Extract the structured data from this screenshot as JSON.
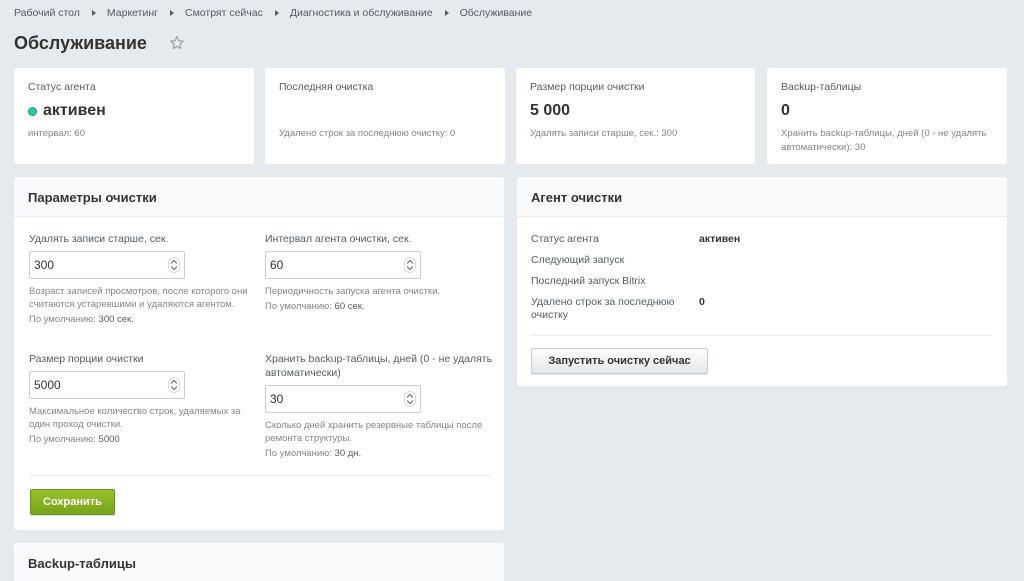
{
  "breadcrumb": [
    "Рабочий стол",
    "Маркетинг",
    "Смотрят сейчас",
    "Диагностика и обслуживание",
    "Обслуживание"
  ],
  "page_title": "Обслуживание",
  "colors": {
    "status_active": "#2fc6a4",
    "save_button": "#7db21d",
    "background": "#e4eaed"
  },
  "stats": [
    {
      "label": "Статус агента",
      "value": "активен",
      "note": "интервал: 60"
    },
    {
      "label": "Последняя очистка",
      "value": "",
      "note": "Удалено строк за последнюю очистку: 0"
    },
    {
      "label": "Размер порции очистки",
      "value": "5 000",
      "note": "Удалять записи старше, сек.: 300"
    },
    {
      "label": "Backup-таблицы",
      "value": "0",
      "note": "Хранить backup-таблицы, дней (0 - не удалять автоматически): 30"
    }
  ],
  "params": {
    "title": "Параметры очистки",
    "fields": [
      {
        "label": "Удалять записи старше, сек.",
        "value": "300",
        "help": "Возраст записей просмотров, после которого они считаются устаревшими и удаляются агентом.",
        "default_label": "По умолчанию:",
        "default_value": "300 сек."
      },
      {
        "label": "Интервал агента очистки, сек.",
        "value": "60",
        "help": "Периодичность запуска агента очистки.",
        "default_label": "По умолчанию:",
        "default_value": "60 сек."
      },
      {
        "label": "Размер порции очистки",
        "value": "5000",
        "help": "Максимальное количество строк, удаляемых за один проход очистки.",
        "default_label": "По умолчанию:",
        "default_value": "5000"
      },
      {
        "label": "Хранить backup-таблицы, дней (0 - не удалять автоматически)",
        "value": "30",
        "help": "Сколько дней хранить резервные таблицы после ремонта структуры.",
        "default_label": "По умолчанию:",
        "default_value": "30 дн."
      }
    ],
    "save_label": "Сохранить"
  },
  "agent": {
    "title": "Агент очистки",
    "rows": [
      {
        "label": "Статус агента",
        "value": "активен"
      },
      {
        "label": "Следующий запуск",
        "value": ""
      },
      {
        "label": "Последний запуск Bitrix",
        "value": ""
      },
      {
        "label": "Удалено строк за последнюю очистку",
        "value": "0"
      }
    ],
    "run_label": "Запустить очистку сейчас"
  },
  "backup": {
    "title": "Backup-таблицы"
  }
}
